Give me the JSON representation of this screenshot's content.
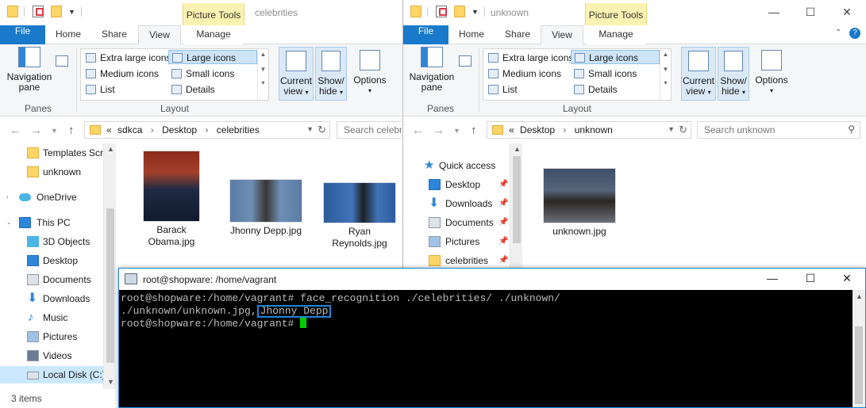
{
  "left_window": {
    "title": "celebrities",
    "context_tab": "Picture Tools",
    "tabs": [
      "File",
      "Home",
      "Share",
      "View",
      "Manage"
    ],
    "ribbon": {
      "navigation_pane_label": "Navigation",
      "navigation_pane_label2": "pane",
      "panes_group": "Panes",
      "layout_group": "Layout",
      "layout_items": [
        "Extra large icons",
        "Large icons",
        "Medium icons",
        "Small icons",
        "List",
        "Details"
      ],
      "current_view_label": "Current",
      "current_view_label2": "view",
      "show_hide_label": "Show/",
      "show_hide_label2": "hide",
      "options_label": "Options"
    },
    "breadcrumb": {
      "prefix": "«",
      "parts": [
        "sdkca",
        "Desktop",
        "celebrities"
      ],
      "sep": "›"
    },
    "search_placeholder": "Search celebriti",
    "nav_items": [
      {
        "label": "Templates Scre",
        "icon": "folder-icon"
      },
      {
        "label": "unknown",
        "icon": "folder-icon"
      },
      {
        "label": "OneDrive",
        "icon": "onedrive-icon"
      },
      {
        "label": "This PC",
        "icon": "pc-icon"
      },
      {
        "label": "3D Objects",
        "icon": "3d-objects-icon"
      },
      {
        "label": "Desktop",
        "icon": "desktop-icon"
      },
      {
        "label": "Documents",
        "icon": "documents-icon"
      },
      {
        "label": "Downloads",
        "icon": "downloads-icon"
      },
      {
        "label": "Music",
        "icon": "music-icon"
      },
      {
        "label": "Pictures",
        "icon": "pictures-icon"
      },
      {
        "label": "Videos",
        "icon": "videos-icon"
      },
      {
        "label": "Local Disk (C:)",
        "icon": "disk-icon"
      }
    ],
    "files": [
      {
        "name_line1": "Barack",
        "name_line2": "Obama.jpg"
      },
      {
        "name_line1": "Jhonny Depp.jpg",
        "name_line2": ""
      },
      {
        "name_line1": "Ryan",
        "name_line2": "Reynolds.jpg"
      }
    ],
    "status": "3 items"
  },
  "right_window": {
    "title": "unknown",
    "context_tab": "Picture Tools",
    "tabs": [
      "File",
      "Home",
      "Share",
      "View",
      "Manage"
    ],
    "ribbon": {
      "navigation_pane_label": "Navigation",
      "navigation_pane_label2": "pane",
      "panes_group": "Panes",
      "layout_group": "Layout",
      "layout_items": [
        "Extra large icons",
        "Large icons",
        "Medium icons",
        "Small icons",
        "List",
        "Details"
      ],
      "current_view_label": "Current",
      "current_view_label2": "view",
      "show_hide_label": "Show/",
      "show_hide_label2": "hide",
      "options_label": "Options"
    },
    "breadcrumb": {
      "prefix": "«",
      "parts": [
        "Desktop",
        "unknown"
      ],
      "sep": "›"
    },
    "search_placeholder": "Search unknown",
    "nav_items": [
      {
        "label": "Quick access",
        "icon": "star-icon"
      },
      {
        "label": "Desktop",
        "icon": "desktop-icon"
      },
      {
        "label": "Downloads",
        "icon": "downloads-icon"
      },
      {
        "label": "Documents",
        "icon": "documents-icon"
      },
      {
        "label": "Pictures",
        "icon": "pictures-icon"
      },
      {
        "label": "celebrities",
        "icon": "folder-icon"
      }
    ],
    "files": [
      {
        "name_line1": "unknown.jpg",
        "name_line2": ""
      }
    ]
  },
  "terminal": {
    "title": "root@shopware: /home/vagrant",
    "line1": "root@shopware:/home/vagrant# face_recognition ./celebrities/ ./unknown/",
    "line2_prefix": "./unknown/unknown.jpg,",
    "line2_match": "Jhonny Depp",
    "line3": "root@shopware:/home/vagrant# "
  },
  "colors": {
    "accent": "#1979ca",
    "context_tab": "#fcf2b1",
    "terminal_bg": "#000000",
    "cursor": "#00d000",
    "highlight_box": "#1f86d8"
  }
}
